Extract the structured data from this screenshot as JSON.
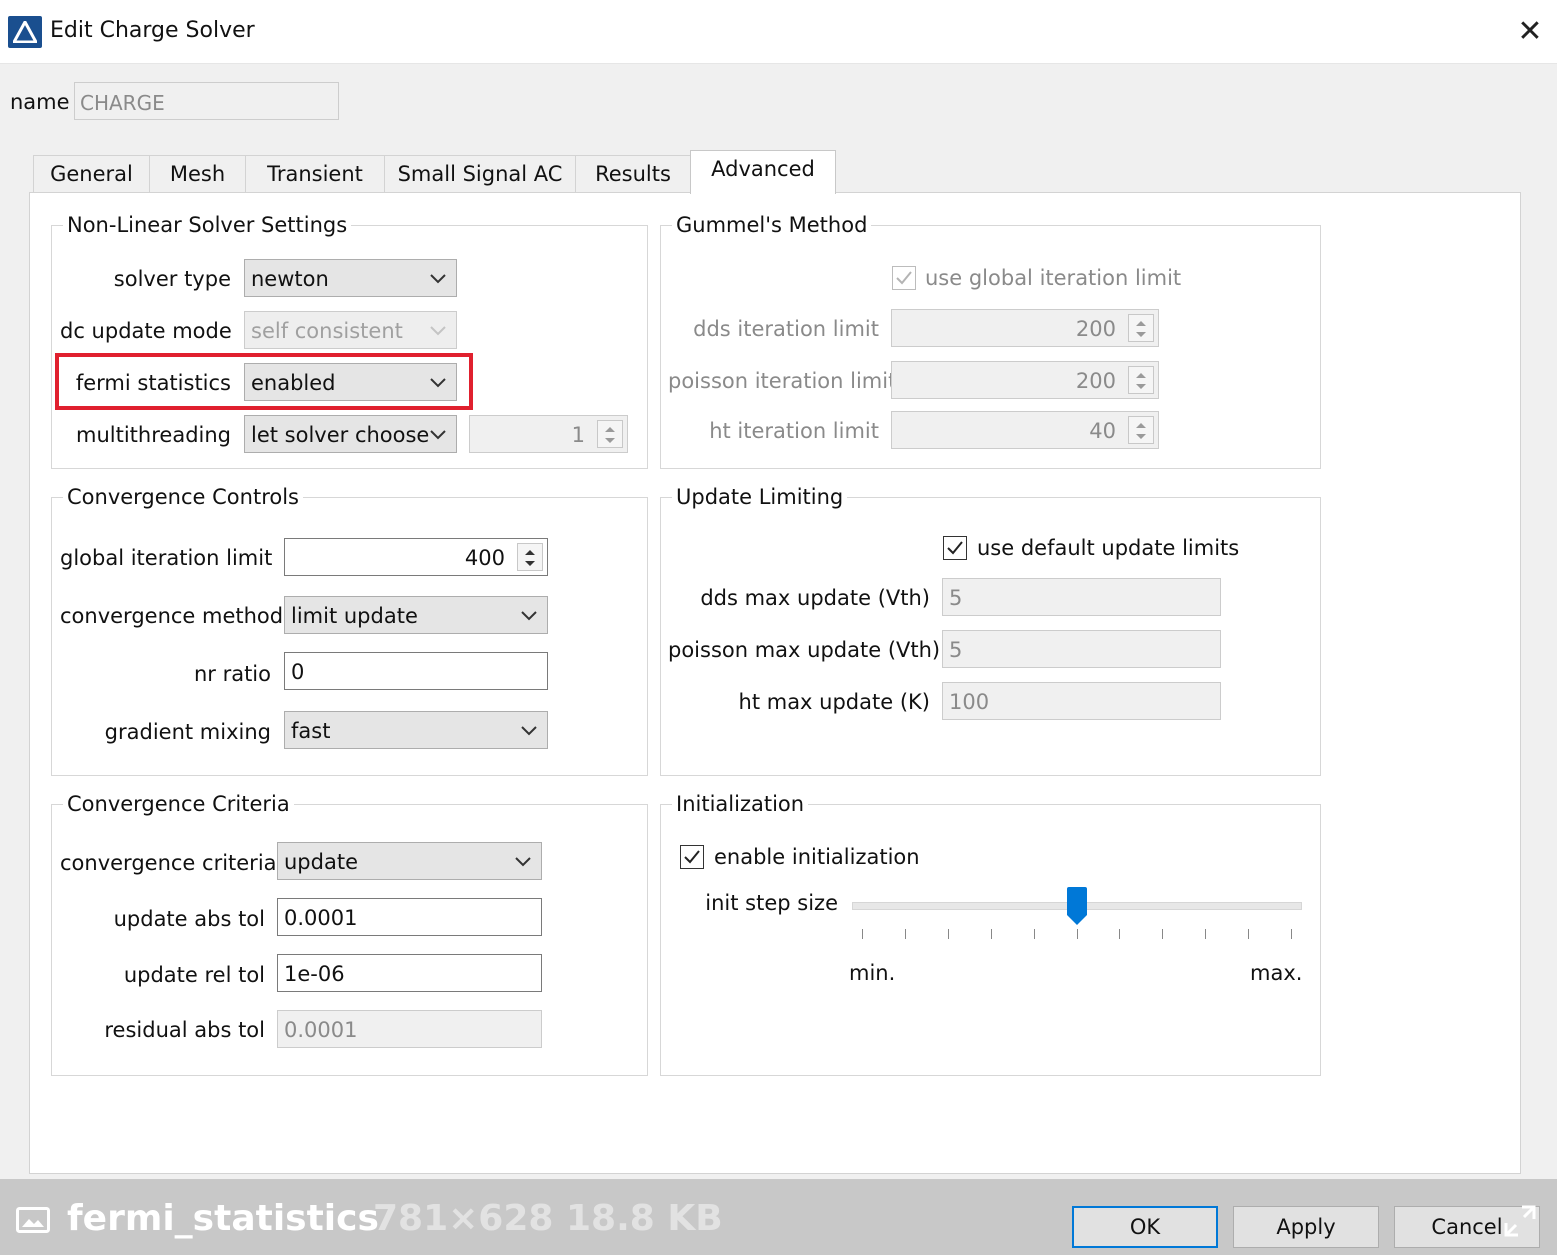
{
  "window": {
    "title": "Edit Charge Solver",
    "icon": "app-triangle-icon",
    "close_icon": "close-icon",
    "close_glyph": "✕"
  },
  "name_row": {
    "label": "name",
    "value": "CHARGE"
  },
  "tabs": [
    {
      "label": "General",
      "active": false
    },
    {
      "label": "Mesh",
      "active": false
    },
    {
      "label": "Transient",
      "active": false
    },
    {
      "label": "Small Signal AC",
      "active": false
    },
    {
      "label": "Results",
      "active": false
    },
    {
      "label": "Advanced",
      "active": true
    }
  ],
  "nonlinear": {
    "title": "Non-Linear Solver Settings",
    "solver_type": {
      "label": "solver type",
      "value": "newton"
    },
    "dc_update_mode": {
      "label": "dc update mode",
      "value": "self consistent",
      "disabled": true
    },
    "fermi_statistics": {
      "label": "fermi statistics",
      "value": "enabled",
      "highlighted": true
    },
    "multithreading": {
      "label": "multithreading",
      "value": "let solver choose",
      "threads": "1"
    }
  },
  "gummel": {
    "title": "Gummel's Method",
    "use_global": {
      "label": "use global iteration limit",
      "checked": true,
      "disabled": true
    },
    "dds": {
      "label": "dds iteration limit",
      "value": "200"
    },
    "poisson": {
      "label": "poisson iteration limit",
      "value": "200"
    },
    "ht": {
      "label": "ht iteration limit",
      "value": "40"
    }
  },
  "convergence_controls": {
    "title": "Convergence Controls",
    "global_iteration_limit": {
      "label": "global iteration limit",
      "value": "400"
    },
    "convergence_method": {
      "label": "convergence method",
      "value": "limit update"
    },
    "nr_ratio": {
      "label": "nr ratio",
      "value": "0"
    },
    "gradient_mixing": {
      "label": "gradient mixing",
      "value": "fast"
    }
  },
  "update_limiting": {
    "title": "Update Limiting",
    "use_default": {
      "label": "use default update limits",
      "checked": true
    },
    "dds_max": {
      "label": "dds max update (Vth)",
      "value": "5"
    },
    "poisson_max": {
      "label": "poisson  max update (Vth)",
      "value": "5"
    },
    "ht_max": {
      "label": "ht max update (K)",
      "value": "100"
    }
  },
  "convergence_criteria": {
    "title": "Convergence Criteria",
    "criteria": {
      "label": "convergence criteria",
      "value": "update"
    },
    "update_abs_tol": {
      "label": "update abs tol",
      "value": "0.0001"
    },
    "update_rel_tol": {
      "label": "update rel tol",
      "value": "1e-06"
    },
    "residual_abs_tol": {
      "label": "residual abs tol",
      "value": "0.0001",
      "disabled": true
    }
  },
  "initialization": {
    "title": "Initialization",
    "enable": {
      "label": "enable initialization",
      "checked": true
    },
    "init_step": {
      "label": "init step size",
      "level": 0.5,
      "ticks": 11,
      "min_label": "min.",
      "max_label": "max."
    }
  },
  "buttons": {
    "ok": "OK",
    "apply": "Apply",
    "cancel": "Cancel"
  },
  "overlay": {
    "file_name": "fermi_statistics",
    "meta": "781×628 18.8 KB",
    "image_icon": "image-icon",
    "expand_icon": "expand-icon"
  },
  "colors": {
    "highlight": "#e0202e",
    "accent": "#0078d7",
    "app_icon": "#1a4f8f"
  }
}
